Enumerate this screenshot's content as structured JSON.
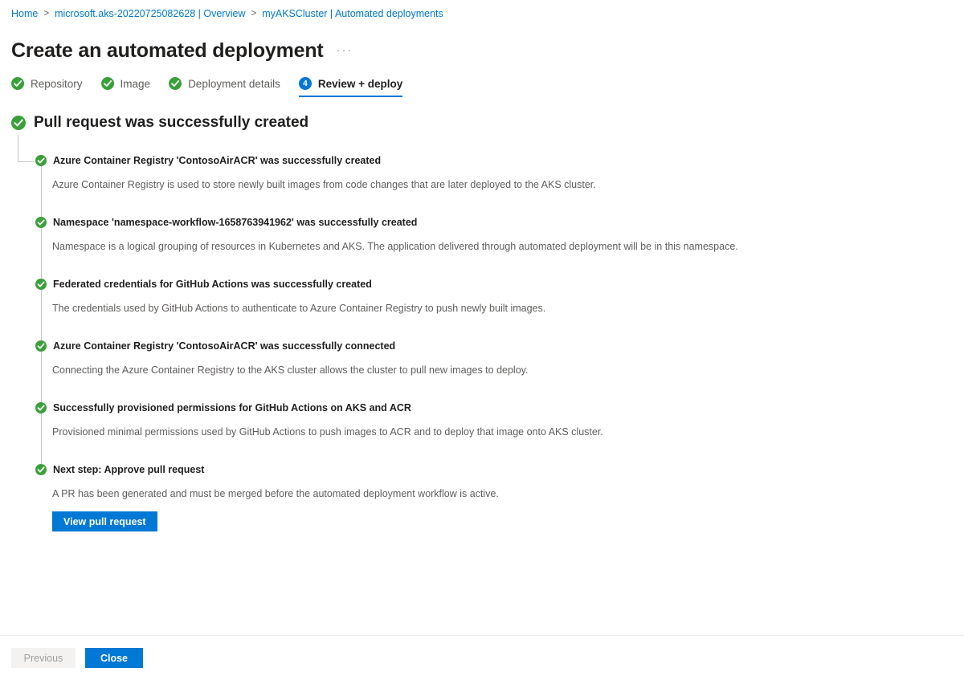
{
  "breadcrumb": {
    "items": [
      {
        "label": "Home"
      },
      {
        "label": "microsoft.aks-20220725082628 | Overview"
      },
      {
        "label": "myAKSCluster | Automated deployments"
      }
    ],
    "separator": ">"
  },
  "header": {
    "title": "Create an automated deployment",
    "more_menu": "···"
  },
  "wizard": {
    "tabs": [
      {
        "label": "Repository",
        "state": "complete",
        "icon": "check-circle-icon"
      },
      {
        "label": "Image",
        "state": "complete",
        "icon": "check-circle-icon"
      },
      {
        "label": "Deployment details",
        "state": "complete",
        "icon": "check-circle-icon"
      },
      {
        "label": "Review + deploy",
        "state": "active",
        "icon": "step-number-badge",
        "number": "4"
      }
    ]
  },
  "result": {
    "heading": "Pull request was successfully created",
    "heading_icon": "check-circle-icon",
    "items": [
      {
        "title": "Azure Container Registry 'ContosoAirACR' was successfully created",
        "description": "Azure Container Registry is used to store newly built images from code changes that are later deployed to the AKS cluster."
      },
      {
        "title": "Namespace 'namespace-workflow-1658763941962' was successfully created",
        "description": "Namespace is a logical grouping of resources in Kubernetes and AKS. The application delivered through automated deployment will be in this namespace."
      },
      {
        "title": "Federated credentials for GitHub Actions was successfully created",
        "description": "The credentials used by GitHub Actions to authenticate to Azure Container Registry to push newly built images."
      },
      {
        "title": "Azure Container Registry 'ContosoAirACR' was successfully connected",
        "description": "Connecting the Azure Container Registry to the AKS cluster allows the cluster to pull new images to deploy."
      },
      {
        "title": "Successfully provisioned permissions for GitHub Actions on AKS and ACR",
        "description": "Provisioned minimal permissions used by GitHub Actions to push images to ACR and to deploy that image onto AKS cluster."
      },
      {
        "title": "Next step: Approve pull request",
        "description": "A PR has been generated and must be merged before the automated deployment workflow is active.",
        "button": "View pull request"
      }
    ]
  },
  "footer": {
    "previous_label": "Previous",
    "close_label": "Close"
  },
  "colors": {
    "accent": "#0078d4",
    "success": "#107c10",
    "link": "#0078d4",
    "text": "#201f1e",
    "muted": "#605e5c",
    "line": "#c8c6c4"
  }
}
